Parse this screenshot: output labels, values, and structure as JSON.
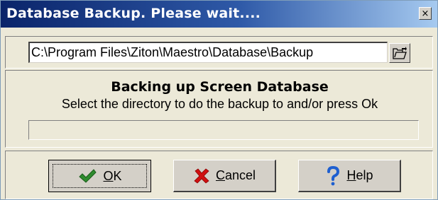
{
  "dialog": {
    "title": "Database Backup. Please wait....",
    "close_glyph": "×"
  },
  "path": {
    "value": "C:\\Program Files\\Ziton\\Maestro\\Database\\Backup"
  },
  "status": {
    "heading": "Backing up Screen Database",
    "message": "Select the directory to do the backup to and/or press Ok",
    "progress": 0
  },
  "buttons": {
    "ok": {
      "accel": "O",
      "rest": "K",
      "icon": "checkmark-icon"
    },
    "cancel": {
      "accel": "C",
      "rest": "ancel",
      "icon": "red-x-icon"
    },
    "help": {
      "accel": "H",
      "rest": "elp",
      "icon": "question-mark-icon"
    }
  },
  "colors": {
    "title_bar_start": "#0a246a",
    "title_bar_end": "#a6caf0",
    "ok_icon": "#2e8b2e",
    "cancel_icon": "#d01010",
    "help_icon": "#1e5fd0"
  }
}
